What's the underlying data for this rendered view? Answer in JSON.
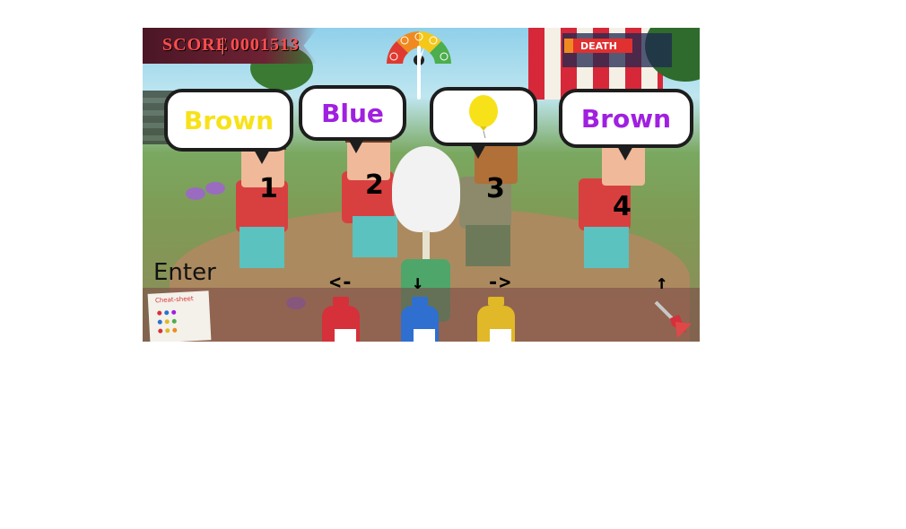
{
  "hud": {
    "score_label": "SCORE",
    "score_value": "0001513",
    "death_label": "DEATH"
  },
  "bubbles": [
    {
      "text": "Brown",
      "color": "#f7e21a"
    },
    {
      "text": "Blue",
      "color": "#a020e0"
    },
    {
      "icon": "balloon-icon",
      "color": "#f7e21a"
    },
    {
      "text": "Brown",
      "color": "#a020e0"
    }
  ],
  "characters": [
    {
      "number": "1"
    },
    {
      "number": "2"
    },
    {
      "number": "3"
    },
    {
      "number": "4"
    }
  ],
  "controls": {
    "enter_label": "Enter",
    "left_arrow": "<-",
    "down_arrow": "↓",
    "right_arrow": "->",
    "up_arrow": "↑",
    "cheat_sheet": "Cheat-sheet",
    "paint_colors": [
      "#d6303a",
      "#2f6fd0",
      "#e0b828"
    ]
  }
}
